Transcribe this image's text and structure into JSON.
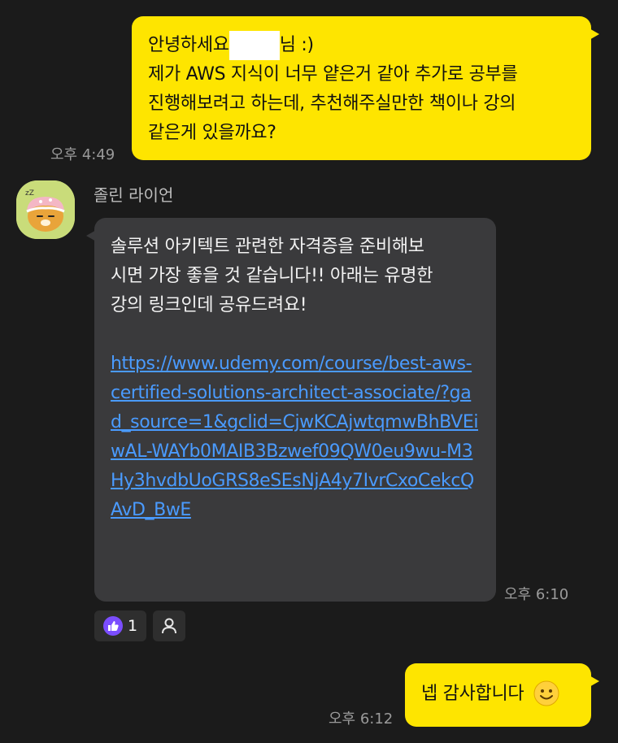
{
  "messages": {
    "first": {
      "line1_before": "안녕하세요",
      "line1_after": "님 :)",
      "rest": "제가 AWS 지식이 너무 얕은거 같아 추가로 공부를\n진행해보려고 하는데, 추천해주실만한 책이나 강의\n같은게 있을까요?",
      "time": "오후 4:49"
    },
    "reply": {
      "sender": "졸린 라이언",
      "text": "솔루션 아키텍트 관련한 자격증을 준비해보\n시면 가장 좋을 것 같습니다!! 아래는 유명한\n강의 링크인데 공유드려요!",
      "link": "https://www.udemy.com/course/best-aws-certified-solutions-architect-associate/?gad_source=1&gclid=CjwKCAjwtqmwBhBVEiwAL-WAYb0MAIB3Bzwef09QW0eu9wu-M3Hy3hvdbUoGRS8eSEsNjA4y7IvrCxoCekcQAvD_BwE",
      "time": "오후 6:10",
      "reaction_count": "1"
    },
    "last": {
      "text": "넵 감사합니다",
      "time": "오후 6:12"
    }
  },
  "colors": {
    "background": "#1b1b1b",
    "my_bubble": "#fee500",
    "other_bubble": "#3a3a3c",
    "link": "#4a9bff",
    "reaction_badge": "#7b4dff"
  },
  "icons": {
    "reaction": "thumbs-up-icon",
    "add_reaction": "person-icon",
    "emoji": "smiling-face-icon"
  }
}
